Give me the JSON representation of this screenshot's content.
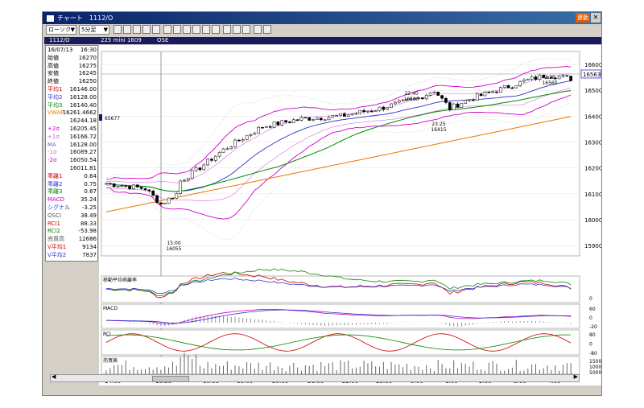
{
  "window": {
    "title": "チャート　1112/O",
    "renraku_label": "連動",
    "close_label": "✕"
  },
  "toolbar": {
    "chart_type": "ローソク",
    "interval": "5分足"
  },
  "info": {
    "code": "1112/O",
    "name": "225 mini 1609",
    "exchange": "OSE"
  },
  "sidebar": [
    {
      "label": "16/07/13",
      "value": "16:30",
      "color": "#000000"
    },
    {
      "label": "始値",
      "value": "16270",
      "color": "#000000"
    },
    {
      "label": "高値",
      "value": "16275",
      "color": "#000000"
    },
    {
      "label": "安値",
      "value": "16245",
      "color": "#000000"
    },
    {
      "label": "終値",
      "value": "16250",
      "color": "#000000"
    },
    {
      "label": "平均1",
      "value": "16146.00",
      "color": "#cc0000"
    },
    {
      "label": "平均2",
      "value": "16128.00",
      "color": "#3333cc"
    },
    {
      "label": "平均3",
      "value": "16140.40",
      "color": "#008800"
    },
    {
      "label": "VWAP",
      "value": "16261.4662",
      "color": "#ee7700"
    },
    {
      "label": "",
      "value": "16244.18",
      "color": "#000000"
    },
    {
      "label": "+2σ",
      "value": "16205.45",
      "color": "#cc00cc"
    },
    {
      "label": "+1σ",
      "value": "16166.72",
      "color": "#cc66cc"
    },
    {
      "label": "MA",
      "value": "16128.00",
      "color": "#6666cc"
    },
    {
      "label": "-1σ",
      "value": "16089.27",
      "color": "#cc66cc"
    },
    {
      "label": "-2σ",
      "value": "16050.54",
      "color": "#cc00cc"
    },
    {
      "label": "",
      "value": "16011.81",
      "color": "#000000"
    },
    {
      "label": "乖離1",
      "value": "0.64",
      "color": "#cc0000"
    },
    {
      "label": "乖離2",
      "value": "0.75",
      "color": "#3333cc"
    },
    {
      "label": "乖離3",
      "value": "0.67",
      "color": "#008800"
    },
    {
      "label": "MACD",
      "value": "35.24",
      "color": "#cc00cc"
    },
    {
      "label": "シグナル",
      "value": "-3.25",
      "color": "#3333cc"
    },
    {
      "label": "OSCI",
      "value": "38.49",
      "color": "#555555"
    },
    {
      "label": "RCI1",
      "value": "88.33",
      "color": "#cc0000"
    },
    {
      "label": "RCI2",
      "value": "-53.98",
      "color": "#008800"
    },
    {
      "label": "売買高",
      "value": "12686",
      "color": "#555555"
    },
    {
      "label": "V平均1",
      "value": "9134",
      "color": "#cc0000"
    },
    {
      "label": "V平均2",
      "value": "7837",
      "color": "#3333cc"
    }
  ],
  "chart_data": {
    "type": "candlestick",
    "x_ticks": [
      "14:00",
      "16:30",
      "18:00",
      "19:00",
      "20:00",
      "21:00",
      "22:00",
      "23:00",
      "0:00",
      "1:00",
      "2:00",
      "3:00",
      "4:00"
    ],
    "y_ticks": [
      15900,
      16000,
      16100,
      16200,
      16300,
      16400,
      16500,
      16600
    ],
    "ylim": [
      15860,
      16650
    ],
    "current_price": "16563",
    "left_marker": "65677",
    "annotations": [
      {
        "time_label": "15:00",
        "price": "16055"
      },
      {
        "time_label": "22:40",
        "price": "16500"
      },
      {
        "time_label": "23:25",
        "price": "16415"
      },
      {
        "time_label": "2:35",
        "price": "16560"
      }
    ],
    "panels": [
      {
        "title": "移動平均乖離率",
        "ticks": [
          "0"
        ]
      },
      {
        "title": "MACD",
        "ticks": [
          "60",
          "0",
          "-20"
        ]
      },
      {
        "title": "RCI",
        "ticks": [
          "80",
          "0",
          "-80"
        ]
      },
      {
        "title": "売買高",
        "ticks": [
          "15000",
          "10000",
          "5000"
        ]
      }
    ],
    "colors": {
      "candle_up": "#ffffff",
      "candle_down": "#000000",
      "ma1": "#cc0000",
      "ma2": "#3333cc",
      "ma3": "#008800",
      "vwap": "#ee7700",
      "band": "#cc00cc"
    }
  }
}
